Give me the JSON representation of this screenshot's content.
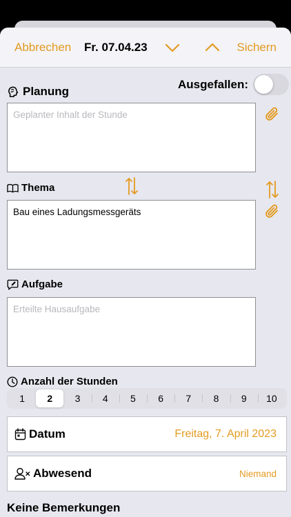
{
  "navbar": {
    "cancel_label": "Abbrechen",
    "date": "Fr. 07.04.23",
    "save_label": "Sichern"
  },
  "planung": {
    "label": "Planung",
    "placeholder": "Geplanter Inhalt der Stunde",
    "value": ""
  },
  "ausgefallen": {
    "label": "Ausgefallen:",
    "on": false
  },
  "thema": {
    "label": "Thema",
    "value": "Bau eines Ladungsmessgeräts"
  },
  "aufgabe": {
    "label": "Aufgabe",
    "placeholder": "Erteilte Hausaufgabe",
    "value": ""
  },
  "stunden": {
    "label": "Anzahl der Stunden",
    "options": [
      "1",
      "2",
      "3",
      "4",
      "5",
      "6",
      "7",
      "8",
      "9",
      "10"
    ],
    "selected": "2"
  },
  "datum": {
    "label": "Datum",
    "value": "Freitag, 7. April 2023"
  },
  "abwesend": {
    "label": "Abwesend",
    "value": "Niemand"
  },
  "bemerkungen": {
    "label": "Keine Bemerkungen"
  },
  "colors": {
    "accent": "#e39a1f",
    "background": "#e7e7ef",
    "navbar": "#f3f3f8"
  },
  "icons": {
    "planung": "brain-head-icon",
    "thema": "book-icon",
    "aufgabe": "pencil-square-icon",
    "stunden": "clock-icon",
    "datum": "calendar-icon",
    "abwesend": "person-x-icon",
    "attach": "paperclip-icon",
    "swap": "swap-arrows-icon",
    "prev": "chevron-down-icon",
    "next": "chevron-up-icon"
  }
}
